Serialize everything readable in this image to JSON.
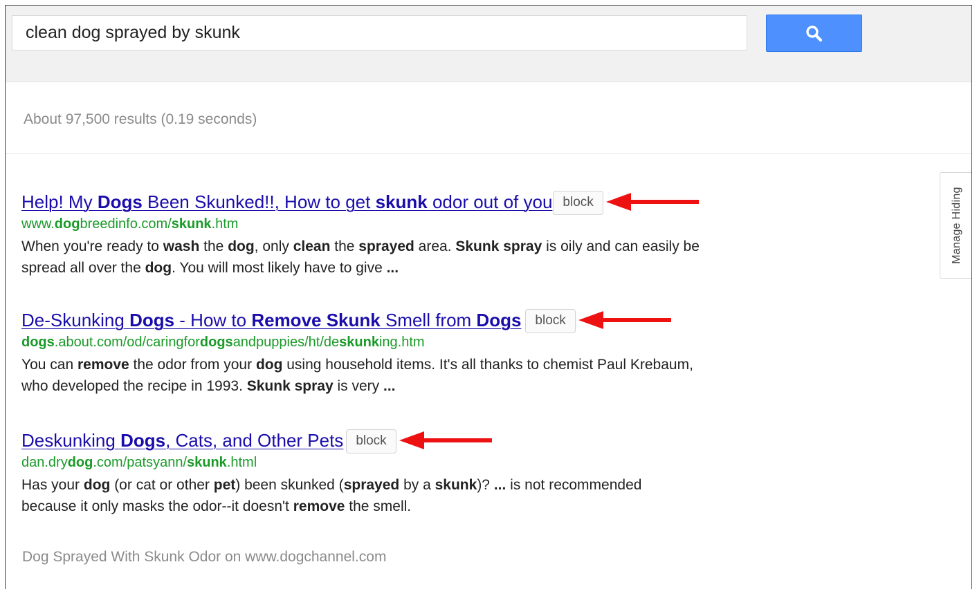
{
  "search": {
    "query": "clean dog sprayed by skunk",
    "button_icon": "search-icon",
    "button_color": "#4d90fe"
  },
  "result_stats": "About 97,500 results (0.19 seconds)",
  "manage_hiding_label": "Manage Hiding",
  "block_label": "block",
  "arrow_color": "#ee1111",
  "colors": {
    "title_link": "#1a0dab",
    "url": "#1a9a28"
  },
  "results": [
    {
      "title_html": "Help! My <b>Dogs</b> Been Skunked!!, How to get <b>skunk</b> odor out of you",
      "url_html": "www.<b>dog</b>breedinfo.com/<b>skunk</b>.htm",
      "snippet_html": "When you're ready to <b>wash</b> the <b>dog</b>, only <b>clean</b> the <b>sprayed</b> area. <b>Skunk spray</b> is oily and can easily be spread all over the <b>dog</b>. You will most likely have to give <b>...</b>"
    },
    {
      "title_html": "De-Skunking <b>Dogs</b> - How to <b>Remove Skunk</b> Smell from <b>Dogs</b>",
      "url_html": "<b>dogs</b>.about.com/od/caringfor<b>dogs</b>andpuppies/ht/de<b>skunk</b>ing.htm",
      "snippet_html": "You can <b>remove</b> the odor from your <b>dog</b> using household items. It's all thanks to chemist Paul Krebaum, who developed the recipe in 1993. <b>Skunk spray</b> is very <b>...</b>"
    },
    {
      "title_html": "Deskunking <b>Dogs</b>, Cats, and Other Pets",
      "url_html": "dan.dry<b>dog</b>.com/patsyann/<b>skunk</b>.html",
      "snippet_html": "Has your <b>dog</b> (or cat or other <b>pet</b>) been skunked (<b>sprayed</b> by a <b>skunk</b>)? <b>...</b> is not recommended because it only masks the odor--it doesn't <b>remove</b> the smell."
    }
  ],
  "footer_text": "Dog Sprayed With Skunk Odor on www.dogchannel.com"
}
